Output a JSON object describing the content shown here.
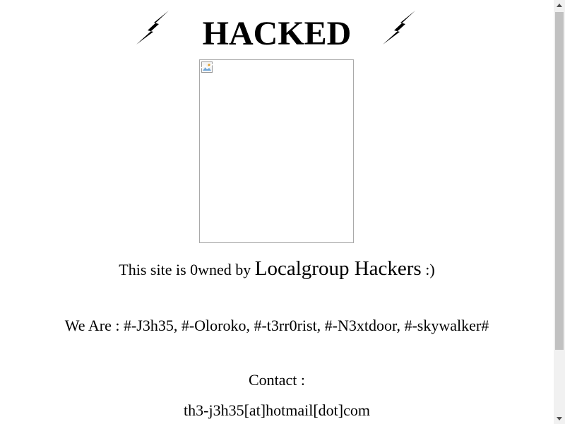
{
  "header": {
    "title": "HACKED",
    "left_icon": "lightning-bolt-icon",
    "right_icon": "lightning-bolt-icon"
  },
  "image": {
    "state": "broken-image",
    "icon": "broken-image-icon"
  },
  "message": {
    "prefix": "This site is 0wned by",
    "group_name": "Localgroup Hackers",
    "suffix": ":)"
  },
  "members": {
    "text": "We Are : #-J3h35, #-Oloroko, #-t3rr0rist, #-N3xtdoor, #-skywalker#"
  },
  "contact": {
    "label": "Contact :",
    "email": "th3-j3h35[at]hotmail[dot]com"
  },
  "colors": {
    "background": "#ffffff",
    "text": "#000000",
    "scrollbar_thumb": "#c1c1c1",
    "scrollbar_track": "#f1f1f1"
  }
}
